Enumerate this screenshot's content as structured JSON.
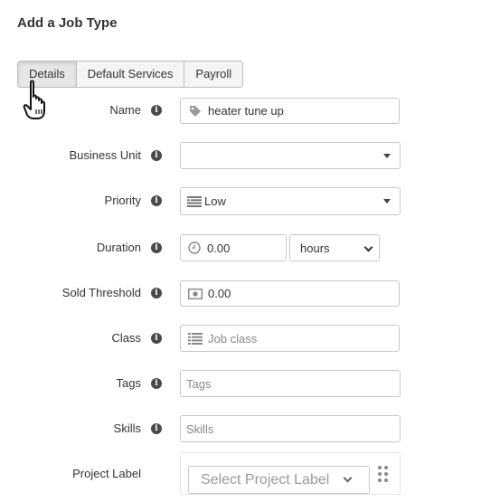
{
  "page": {
    "title": "Add a Job Type"
  },
  "tabs": [
    {
      "label": "Details",
      "active": true
    },
    {
      "label": "Default Services",
      "active": false
    },
    {
      "label": "Payroll",
      "active": false
    }
  ],
  "form": {
    "name": {
      "label": "Name",
      "value": "heater tune up",
      "icon": "tag-icon"
    },
    "business_unit": {
      "label": "Business Unit",
      "value": ""
    },
    "priority": {
      "label": "Priority",
      "value": "Low",
      "icon": "priority-bars-icon"
    },
    "duration": {
      "label": "Duration",
      "value": "0.00",
      "unit": "hours",
      "icon": "clock-icon"
    },
    "sold_threshold": {
      "label": "Sold Threshold",
      "value": "0.00",
      "icon": "money-icon"
    },
    "class": {
      "label": "Class",
      "placeholder": "Job class",
      "icon": "list-icon"
    },
    "tags": {
      "label": "Tags",
      "placeholder": "Tags"
    },
    "skills": {
      "label": "Skills",
      "placeholder": "Skills"
    },
    "project_label": {
      "label": "Project Label",
      "placeholder": "Select Project Label"
    }
  },
  "info_icon": "info-icon",
  "cursor": "hand-pointer-icon"
}
